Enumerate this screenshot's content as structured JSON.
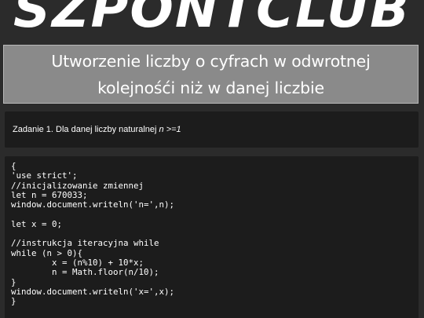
{
  "logo": {
    "text": "SZPONTCLUB"
  },
  "title": {
    "text": "Utworzenie liczby o cyfrach w odwrotnej kolejnośći niż w danej liczbie"
  },
  "task": {
    "prefix": "Zadanie 1. Dla danej liczby naturalnej ",
    "math": "n >=1"
  },
  "code": {
    "text": "{\n'use strict';\n//inicjalizowanie zmiennej\nlet n = 670033;\nwindow.document.writeln('n=',n);\n\nlet x = 0;\n\n//instrukcja iteracyjna while\nwhile (n > 0){\n        x = (n%10) + 10*x;\n        n = Math.floor(n/10);\n}\nwindow.document.writeln('x=',x);\n}"
  }
}
